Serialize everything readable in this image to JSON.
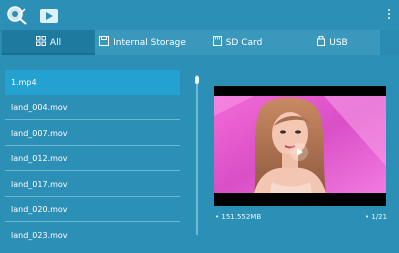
{
  "tabs": [
    {
      "label": "All"
    },
    {
      "label": "Internal Storage"
    },
    {
      "label": "SD Card"
    },
    {
      "label": "USB"
    }
  ],
  "files": [
    {
      "name": "1.mp4",
      "selected": true
    },
    {
      "name": "land_004.mov"
    },
    {
      "name": "land_007.mov"
    },
    {
      "name": "land_012.mov"
    },
    {
      "name": "land_017.mov"
    },
    {
      "name": "land_020.mov"
    },
    {
      "name": "land_023.mov"
    }
  ],
  "preview": {
    "file_size": "151.552MB",
    "position": "1/21"
  },
  "colors": {
    "accent": "#2c8fb5",
    "selected": "#23a1d0",
    "tab_active": "#1f7aa0"
  },
  "icons": [
    "app-logo-icon",
    "play-icon",
    "overflow-menu-icon",
    "grid-icon",
    "storage-icon",
    "sd-card-icon",
    "usb-icon"
  ]
}
